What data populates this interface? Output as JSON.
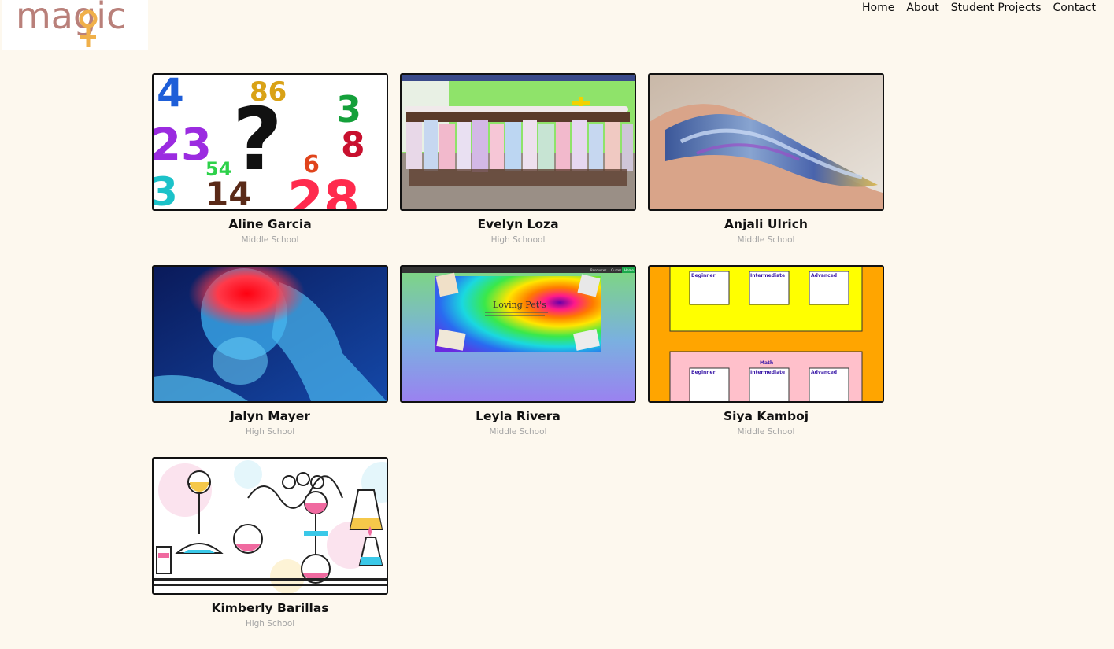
{
  "site": {
    "logo_text": "magic",
    "brand_color": "#b9807a",
    "logo_accent": "#f0b04a"
  },
  "nav": {
    "items": [
      "Home",
      "About",
      "Student Projects",
      "Contact"
    ]
  },
  "projects": [
    {
      "name": "Aline Garcia",
      "level": "Middle School",
      "thumb": "numbers-question-mark"
    },
    {
      "name": "Evelyn Loza",
      "level": "High Schoool",
      "thumb": "children-group-photo"
    },
    {
      "name": "Anjali Ulrich",
      "level": "Middle School",
      "thumb": "slime-hand-photo"
    },
    {
      "name": "Jalyn Mayer",
      "level": "High School",
      "thumb": "xray-headache"
    },
    {
      "name": "Leyla Rivera",
      "level": "Middle School",
      "thumb": "loving-pets-website"
    },
    {
      "name": "Siya Kamboj",
      "level": "Middle School",
      "thumb": "math-levels-website"
    },
    {
      "name": "Kimberly Barillas",
      "level": "High School",
      "thumb": "chemistry-lab-illustration"
    }
  ],
  "thumb_text": {
    "numbers": [
      "4",
      "86",
      "3",
      "23",
      "?",
      "8",
      "54",
      "6",
      "3",
      "14",
      "28"
    ],
    "pets_title": "Loving Pet's",
    "pets_nav": [
      "Resources",
      "Quizes",
      "Home"
    ],
    "math_title": "Math",
    "math_levels": [
      "Beginner",
      "Intermediate",
      "Advanced"
    ]
  }
}
